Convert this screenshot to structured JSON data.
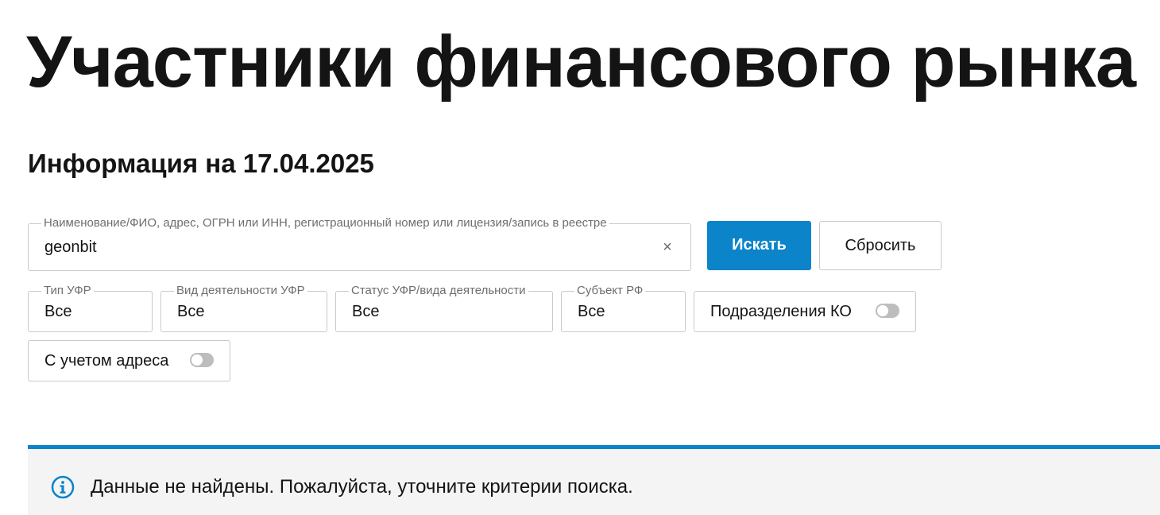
{
  "page": {
    "title": "Участники финансового рынка",
    "info_date": "Информация на 17.04.2025"
  },
  "search": {
    "label": "Наименование/ФИО, адрес, ОГРН или ИНН, регистрационный номер или лицензия/запись в реестре",
    "value": "geonbit",
    "clear_icon": "×",
    "search_button": "Искать",
    "reset_button": "Сбросить"
  },
  "filters": {
    "ufr_type": {
      "label": "Тип УФР",
      "value": "Все"
    },
    "activity_type": {
      "label": "Вид деятельности УФР",
      "value": "Все"
    },
    "status": {
      "label": "Статус УФР/вида деятельности",
      "value": "Все"
    },
    "region": {
      "label": "Субъект РФ",
      "value": "Все"
    },
    "ko_divisions": {
      "label": "Подразделения КО",
      "enabled": false
    },
    "with_address": {
      "label": "С учетом адреса",
      "enabled": false
    }
  },
  "alert": {
    "icon": "info-icon",
    "text": "Данные не найдены. Пожалуйста, уточните критерии поиска."
  },
  "colors": {
    "accent": "#0b84c9",
    "alert_background": "#f4f4f4",
    "toggle_off": "#bdbdbd",
    "border": "#c9c9c9"
  }
}
